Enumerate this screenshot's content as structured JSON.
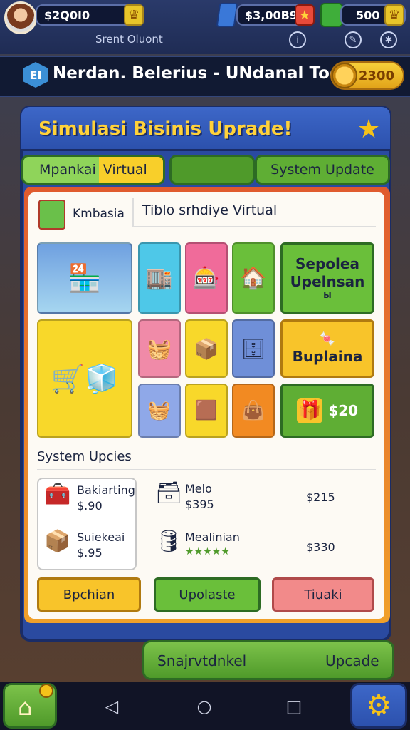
{
  "top_bar": {
    "coins": "$2Q0I0",
    "gems": "$3,00B9",
    "energy": "500",
    "subtitle": "Srent Oluont"
  },
  "nav": {
    "logo": "EI",
    "title": "Nerdan. Belerius - UNdanal  Todan",
    "coins": "2300"
  },
  "panel": {
    "title": "Simulasi Bisinis Uprade!",
    "tabs": [
      "Mpankai",
      "Virtual",
      "",
      "System Update"
    ]
  },
  "shop": {
    "section_label": "Kmbasia",
    "section_title": "Tiblo srhdiye Virtual",
    "big_tiles": [
      "Sepolea",
      "Upelnsan",
      "Ы",
      "Buplaina",
      "$20"
    ]
  },
  "updates": {
    "header": "System Upcies",
    "items": [
      {
        "name": "Bakiarting",
        "price": "$.90"
      },
      {
        "name": "Suiekeai",
        "price": "$.95"
      },
      {
        "name": "Melo",
        "price": "$395"
      },
      {
        "name": "Mealinian",
        "price": "$215"
      },
      {
        "name": "",
        "price": "$330"
      }
    ],
    "stars": "★★★★★"
  },
  "buttons": [
    "Bpchian",
    "Upolaste",
    "Tiuaki"
  ],
  "bottom": {
    "left_label": "Snajrvtdnkel",
    "right_label": "Upcade"
  },
  "colors": {
    "gold": "#f5c21a",
    "panel_blue": "#2a4aa0",
    "green": "#5fae34",
    "orange": "#f4a92a",
    "pink": "#f08080"
  }
}
